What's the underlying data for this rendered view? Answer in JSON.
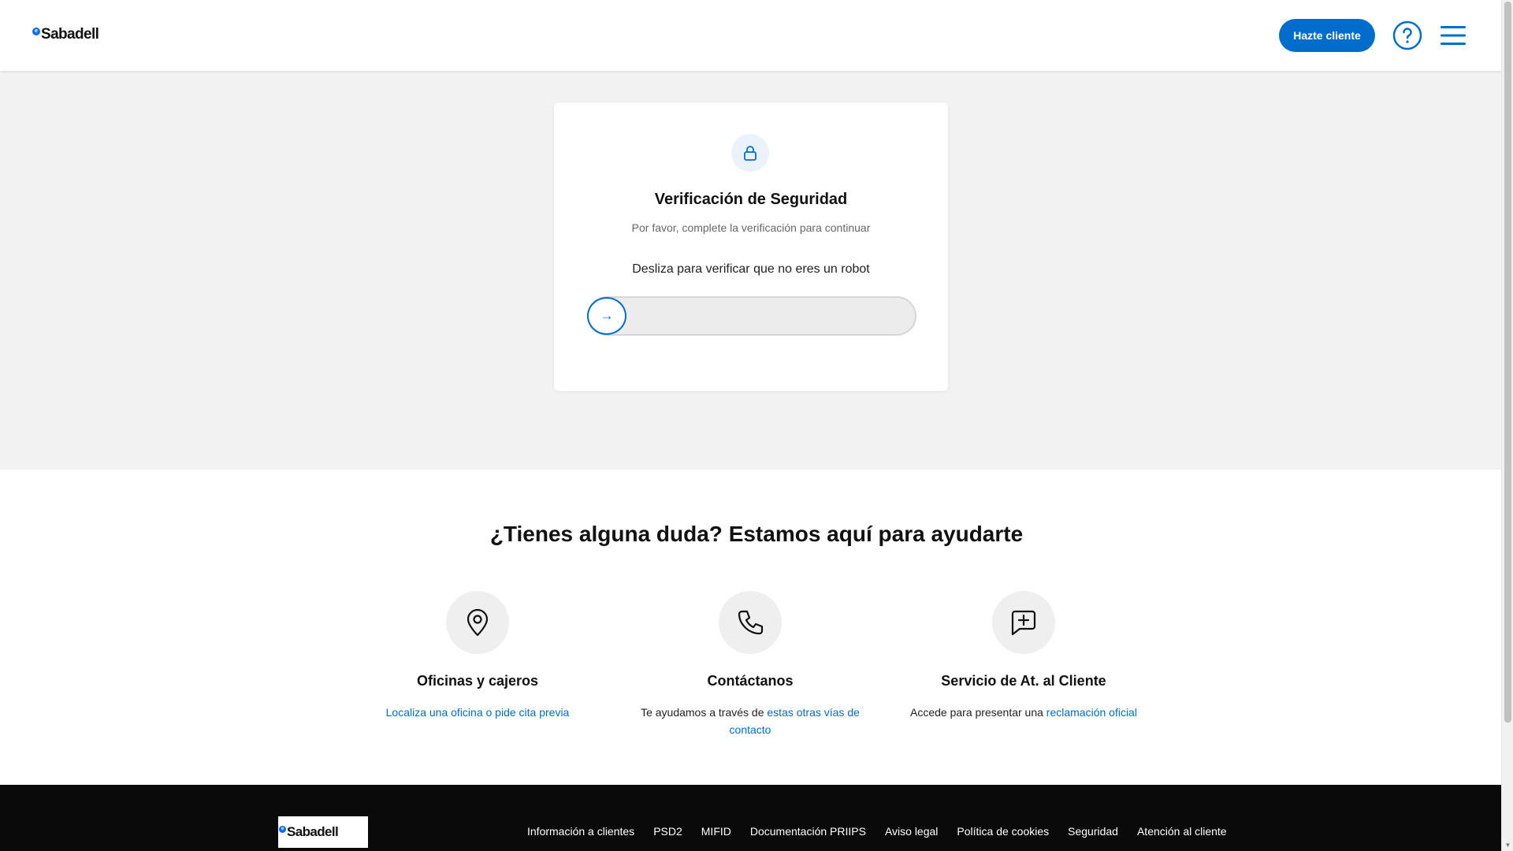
{
  "header": {
    "logo_text": "Sabadell",
    "logo_mark": "e",
    "cta_label": "Hazte cliente",
    "help_icon": "help-circle-icon",
    "menu_icon": "hamburger-menu-icon"
  },
  "verification": {
    "icon": "lock-icon",
    "title": "Verificación de Seguridad",
    "subtitle": "Por favor, complete la verificación para continuar",
    "instruction": "Desliza para verificar que no eres un robot",
    "slider_arrow": "→",
    "slider_progress": 0
  },
  "help": {
    "title": "¿Tienes alguna duda? Estamos aquí para ayudarte",
    "columns": [
      {
        "icon": "map-pin-icon",
        "title": "Oficinas y cajeros",
        "text_before": "",
        "link": "Localiza una oficina o pide cita previa"
      },
      {
        "icon": "phone-icon",
        "title": "Contáctanos",
        "text_before": "Te ayudamos a través de ",
        "link": "estas otras vías de contacto"
      },
      {
        "icon": "message-plus-icon",
        "title": "Servicio de At. al Cliente",
        "text_before": "Accede para presentar una ",
        "link": "reclamación oficial"
      }
    ]
  },
  "footer": {
    "logo_text": "Sabadell",
    "links": [
      "Información a clientes",
      "PSD2",
      "MIFID",
      "Documentación PRIIPS",
      "Aviso legal",
      "Política de cookies",
      "Seguridad",
      "Atención al cliente"
    ]
  },
  "colors": {
    "brand_blue": "#006dcc",
    "background": "#f2f2f2",
    "footer": "#0a0a0a"
  }
}
